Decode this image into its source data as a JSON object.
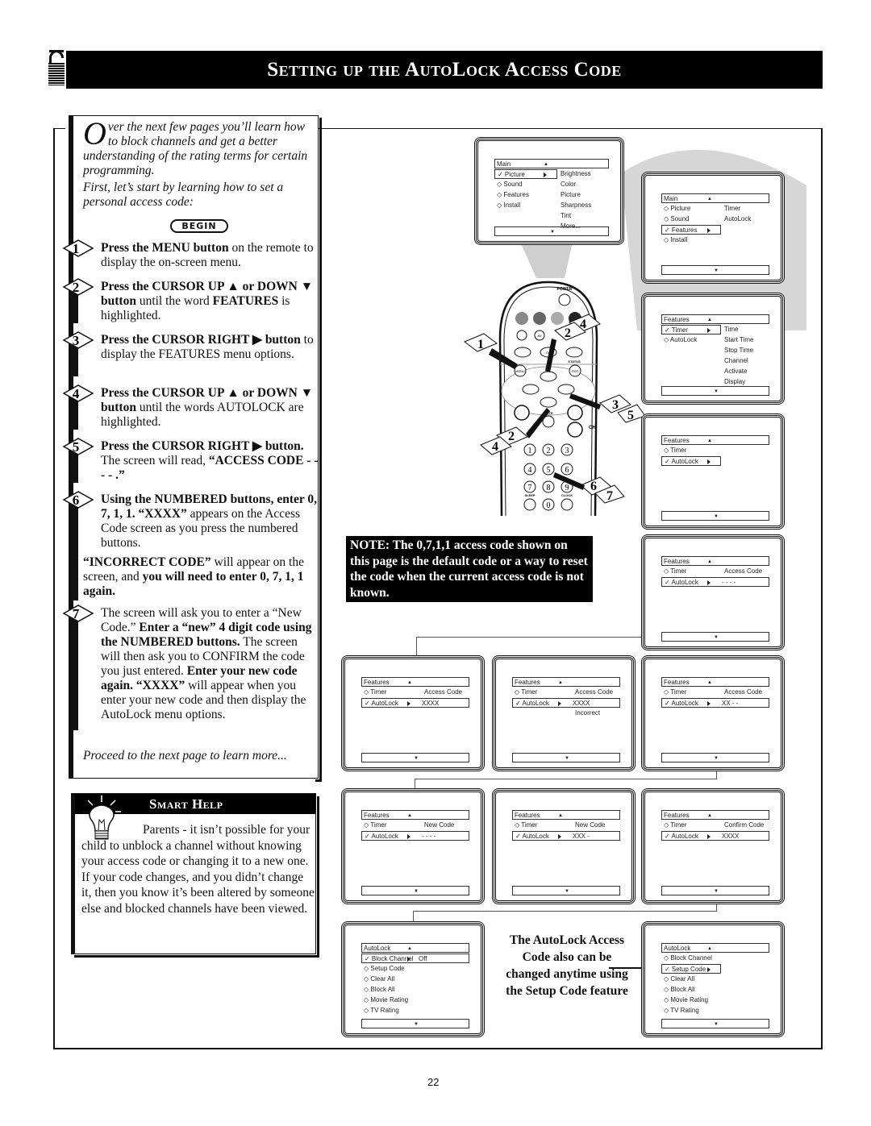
{
  "header": {
    "title": "Setting up the AutoLock Access Code",
    "icon": "padlock-icon"
  },
  "intro": {
    "dropcap": "O",
    "text": "ver the next few pages you’ll learn how to block channels and get a better understanding of the rating terms for certain programming.",
    "text2": "First, let’s start by learning how to set a personal access code:",
    "begin_label": "BEGIN"
  },
  "steps": [
    {
      "num": "1",
      "bold": "Press the MENU button",
      "rest": " on the remote to display the on-screen menu."
    },
    {
      "num": "2",
      "bold": "Press the CURSOR UP ▲ or DOWN ▼ button",
      "rest": " until the word ",
      "bold2": "FEATURES",
      "rest2": " is highlighted."
    },
    {
      "num": "3",
      "bold": "Press the CURSOR RIGHT ▶ button",
      "rest": " to display the FEATURES menu options."
    },
    {
      "num": "4",
      "bold": "Press the CURSOR UP ▲ or DOWN ▼ button",
      "rest": " until the words AUTOLOCK are highlighted."
    },
    {
      "num": "5",
      "bold": "Press the CURSOR RIGHT ▶ button.",
      "rest": " The screen will read, ",
      "bold2": "“ACCESS CODE - - - - .”",
      "rest2": ""
    },
    {
      "num": "6",
      "bold": "Using the NUMBERED buttons, enter 0, 7, 1, 1. “XXXX”",
      "rest": " appears on the Access Code screen as you press the numbered buttons."
    },
    {
      "num": "7",
      "bold": "",
      "rest": "The screen will ask you to enter a “New Code.” ",
      "bold2": "Enter a “new” 4 digit code using the NUMBERED buttons.",
      "rest2": " The screen will then ask you to CONFIRM the code you just entered. ",
      "bold3": "Enter your new code again. “XXXX”",
      "rest3": " will appear when you enter your new code and then display the AutoLock menu options."
    }
  ],
  "incorrect": {
    "bold": "“INCORRECT CODE”",
    "rest": " will appear on the screen, and ",
    "bold2": "you will need to enter 0, 7, 1, 1 again."
  },
  "proceed": "Proceed to the next page to learn more...",
  "smart_help": {
    "title": "Smart Help",
    "text": "Parents - it isn’t possible for your child to unblock a channel without knowing your access code or changing it to a new one. If your code changes, and you didn’t change it, then you know it’s been altered by someone else and blocked channels have been viewed."
  },
  "note": "NOTE: The 0,7,1,1 access code shown on this page is the default code or a way to reset the code when the current access code is not known.",
  "caption": "The AutoLock Access Code also can be changed anytime using the Setup Code feature",
  "remote": {
    "power": "POWER",
    "menu": "MENU",
    "exit": "EXIT",
    "status": "STATUS",
    "mute": "MUTE",
    "ch": "CH",
    "sleep": "SLEEP",
    "clock": "CLOCK",
    "auto_sound": "AUTO SOUND",
    "cc": "CC",
    "auto_picture": "AUTO PICTURE",
    "av": "AV",
    "digits": [
      "1",
      "2",
      "3",
      "4",
      "5",
      "6",
      "7",
      "8",
      "9",
      "0"
    ],
    "callouts": [
      "1",
      "2",
      "4",
      "3",
      "5",
      "2",
      "4",
      "6",
      "7"
    ]
  },
  "screens": {
    "s1": {
      "header": "Main",
      "items": [
        {
          "label": "Picture",
          "selected": true
        },
        {
          "label": "Sound"
        },
        {
          "label": "Features"
        },
        {
          "label": "Install"
        }
      ],
      "sub": [
        "Brightness",
        "Color",
        "Picture",
        "Sharpness",
        "Tint",
        "More..."
      ]
    },
    "s2": {
      "header": "Main",
      "items": [
        {
          "label": "Picture"
        },
        {
          "label": "Sound"
        },
        {
          "label": "Features",
          "selected": true
        },
        {
          "label": "Install"
        }
      ],
      "sub": [
        "Timer",
        "AutoLock"
      ]
    },
    "s3": {
      "header": "Features",
      "items": [
        {
          "label": "Timer",
          "selected": true
        },
        {
          "label": "AutoLock"
        }
      ],
      "sub": [
        "Time",
        "Start Time",
        "Stop Time",
        "Channel",
        "Activate",
        "Display"
      ]
    },
    "s4": {
      "header": "Features",
      "items": [
        {
          "label": "Timer"
        },
        {
          "label": "AutoLock",
          "selected": true
        }
      ],
      "sub": []
    },
    "s5": {
      "header": "Features",
      "items": [
        {
          "label": "Timer"
        },
        {
          "label": "AutoLock",
          "selected": true
        }
      ],
      "label": "Access Code",
      "value": "- - - -"
    },
    "s6": {
      "header": "Features",
      "items": [
        {
          "label": "Timer"
        },
        {
          "label": "AutoLock",
          "selected": true
        }
      ],
      "label": "Access Code",
      "value": "XXXX"
    },
    "s7": {
      "header": "Features",
      "items": [
        {
          "label": "Timer"
        },
        {
          "label": "AutoLock",
          "selected": true
        }
      ],
      "label": "Access Code",
      "value": "XXXX",
      "extra": "Incorrect"
    },
    "s8": {
      "header": "Features",
      "items": [
        {
          "label": "Timer"
        },
        {
          "label": "AutoLock",
          "selected": true
        }
      ],
      "label": "Access Code",
      "value": "XX - -"
    },
    "s9": {
      "header": "Features",
      "items": [
        {
          "label": "Timer"
        },
        {
          "label": "AutoLock",
          "selected": true
        }
      ],
      "label": "New Code",
      "value": "- - - -"
    },
    "s10": {
      "header": "Features",
      "items": [
        {
          "label": "Timer"
        },
        {
          "label": "AutoLock",
          "selected": true
        }
      ],
      "label": "New Code",
      "value": "XXX -"
    },
    "s11": {
      "header": "Features",
      "items": [
        {
          "label": "Timer"
        },
        {
          "label": "AutoLock",
          "selected": true
        }
      ],
      "label": "Confirm Code",
      "value": "XXXX"
    },
    "s12": {
      "header": "AutoLock",
      "items": [
        {
          "label": "Block Channel",
          "selected": true,
          "value": "Off"
        },
        {
          "label": "Setup Code"
        },
        {
          "label": "Clear All"
        },
        {
          "label": "Block All"
        },
        {
          "label": "Movie Rating"
        },
        {
          "label": "TV Rating"
        }
      ]
    },
    "s13": {
      "header": "AutoLock",
      "items": [
        {
          "label": "Block Channel"
        },
        {
          "label": "Setup Code",
          "selected": true
        },
        {
          "label": "Clear All"
        },
        {
          "label": "Block All"
        },
        {
          "label": "Movie Rating"
        },
        {
          "label": "TV Rating"
        }
      ]
    }
  },
  "page_number": "22"
}
